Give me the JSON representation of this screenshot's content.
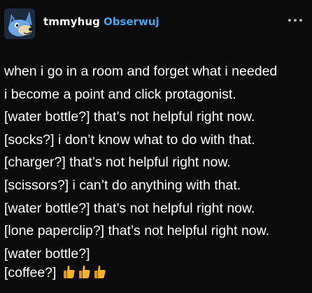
{
  "post": {
    "username": "tmmyhug",
    "follow_label": "Obserwuj",
    "avatar_icon": "blue-heeler-dog-avatar-icon",
    "more_icon": "more-options-icon",
    "lines": [
      "when i go in a room and forget what i needed",
      "i become a point and click protagonist.",
      "[water bottle?] that’s not helpful right now.",
      "[socks?] i don’t know what to do with that.",
      "[charger?] that’s not helpful right now.",
      "[scissors?] i can’t do anything with that.",
      "[water bottle?] that’s not helpful right now.",
      "[lone paperclip?] that’s not helpful right now.",
      "[water bottle?]"
    ],
    "last_line": "[coffee?]",
    "reaction_icon": "thumbs-up-emoji-icon",
    "reaction_count": 3
  },
  "colors": {
    "background": "#0b0b0b",
    "text": "#ffffff",
    "follow": "#4ea1ec",
    "emoji": "#f5b42a"
  }
}
